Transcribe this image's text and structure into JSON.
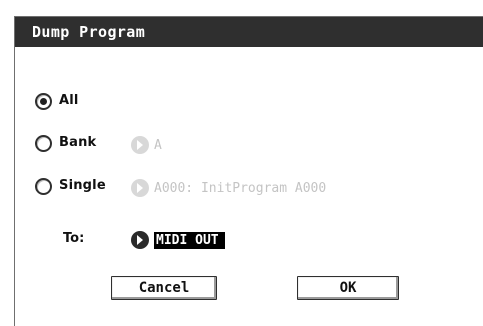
{
  "dialog": {
    "title": "Dump Program",
    "options": [
      {
        "label": "All",
        "selected": true
      },
      {
        "label": "Bank",
        "selected": false
      },
      {
        "label": "Single",
        "selected": false
      }
    ],
    "bank_value": "A",
    "single_value": "A000: InitProgram A000",
    "to_label": "To:",
    "to_value": "MIDI OUT",
    "cancel_label": "Cancel",
    "ok_label": "OK"
  },
  "icons": {
    "selector": "chevron-right-icon"
  }
}
